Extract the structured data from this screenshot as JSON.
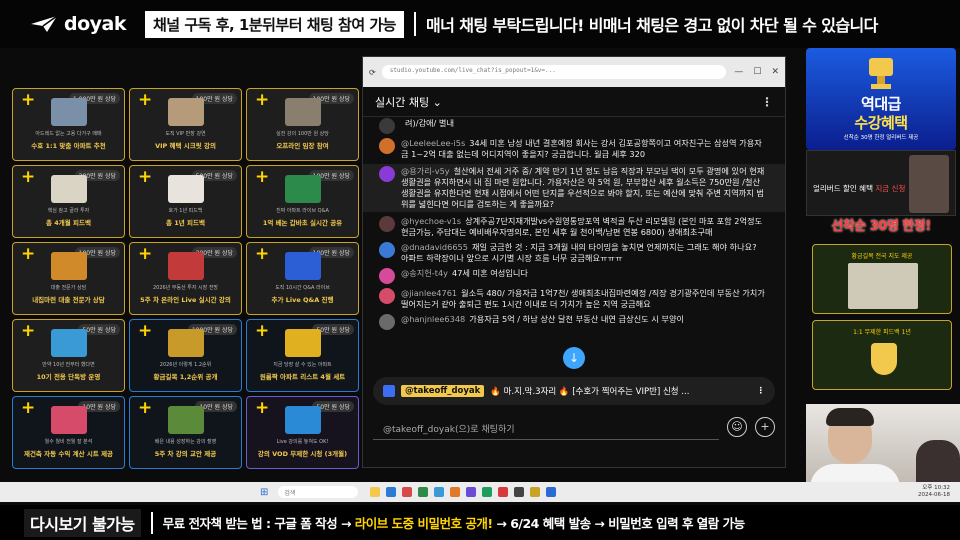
{
  "brand": {
    "name": "doyak"
  },
  "top_notice": {
    "subscribe_text": "채널 구독 후, 1분뒤부터 채팅 참여 가능",
    "manner_text": "매너 채팅 부탁드립니다! 비매너 채팅은 경고 없이 차단 될 수 있습니다"
  },
  "products": [
    {
      "price": "1,000만 원 상당",
      "desc": "아드레드 없는 고용 다가구 매매",
      "title": "수호 1:1 맞춤 아파트 추천",
      "color": "#7a8fa8",
      "style": "gold"
    },
    {
      "price": "100만 원 상당",
      "desc": "도직 VIP 반장 강연",
      "title": "VIP 혜택 시크릿 강의",
      "color": "#b59b7a",
      "style": "gold"
    },
    {
      "price": "100만 원 상당",
      "desc": "실전 강의 100만 원 상당",
      "title": "오프라인 임장 참여",
      "color": "#8a7f6e",
      "style": "gold"
    },
    {
      "price": "300만 원 상당",
      "desc": "핵심 참고 골라 투자",
      "title": "총 4개월 피드백",
      "color": "#d9d4c4",
      "style": "gold"
    },
    {
      "price": "500만 원 상당",
      "desc": "호가 1년 피드백",
      "title": "총 1년 피드백",
      "color": "#e8e3dc",
      "style": "gold"
    },
    {
      "price": "100만 원 상당",
      "desc": "진짜 아파트 라이브 Q&A",
      "title": "1억 베논 갑바초 실시간 공유",
      "color": "#2c8a4a",
      "style": "gold"
    },
    {
      "price": "100만 원 상당",
      "desc": "대출 전문가 상담",
      "title": "내집마련 대출 전문가 상담",
      "color": "#d08a2a",
      "style": "gold"
    },
    {
      "price": "300만 원 상당",
      "desc": "2026년 부동산 투자 시장 전망",
      "title": "5주 차 온라인 Live 실시간 강의",
      "color": "#c23a3a",
      "style": "gold"
    },
    {
      "price": "100만 원 상당",
      "desc": "도직 10시간 Q&A 라이브",
      "title": "추가 Live Q&A 진행",
      "color": "#2c5fd6",
      "style": "gold"
    },
    {
      "price": "50만 원 상당",
      "desc": "만약 10년 전부터 했다면",
      "title": "10기 전용 단독방 운영",
      "color": "#3a9ad6",
      "style": "gold"
    },
    {
      "price": "1000만 원 상당",
      "desc": "2026년 이렇게 1.2순위",
      "title": "황금길목 1,2순위 공개",
      "color": "#c89a2a",
      "style": "blue"
    },
    {
      "price": "50만 원 상당",
      "desc": "지금 당장 살 수 있는 아파트",
      "title": "원룸짝 아파트 리스트 4월 세트",
      "color": "#e0b020",
      "style": "blue"
    },
    {
      "price": "10만 원 상당",
      "desc": "월수 월비 전월 잘 분석",
      "title": "재건축 자동 수익 계산 시트 제공",
      "color": "#d64a6a",
      "style": "blue"
    },
    {
      "price": "10만 원 상당",
      "desc": "배은 내용 성장하는 강의 촬영",
      "title": "5주 차 강의 교안 제공",
      "color": "#5a8a3a",
      "style": "blue"
    },
    {
      "price": "50만 원 상당",
      "desc": "Live 강의를 놓쳐도 OK!",
      "title": "강의 VOD 무제한 시청 (3개월)",
      "color": "#2a8ad6",
      "style": "purple"
    }
  ],
  "browser": {
    "url": "studio.youtube.com/live_chat?is_popout=1&v=..."
  },
  "chat": {
    "header": "실시간 채팅 ⌄",
    "messages": [
      {
        "author": "",
        "text": "려)/감애/ 별내",
        "color": "#3a3a3a"
      },
      {
        "author": "@LeeleeLee-i5s",
        "text": "34세 미혼 남성 내년 결혼예정 회사는 강서 김포공항쪽이고 여자친구는 삼성역 가용자금 1~2억 대출 없는데 어디지역이 좋을지? 궁금합니다. 월급 세후 320",
        "color": "#d0702a"
      },
      {
        "author": "@용가리-v5y",
        "text": "철산에서 전세 거주 중/ 계약 만기 1년 정도 남음 직장과 부모님 댁이 모두 광명에 있어 현재 생활권을 유지하면서 내 집 마련 원합니다. 가용자산은 약 5억 원, 부부합산 세후 월소득은 750만원 /철산 생활권을 유지한다면 현재 시점에서 어떤 단지를 우선적으로 봐야 할지, 또는 예산에 맞춰 주변 지역까지 범위를 넓힌다면 어디를 검토하는 게 좋을까요?",
        "color": "#8a3ad6",
        "highlight": true
      },
      {
        "author": "@hyechoe-v1s",
        "text": "상계주공7단지재개발vs수원영통망포역 벽적골 두산 리모델링 (본인 마포 포함 2억정도 현금가능, 주담대는 예비배우자명의로, 본인 세후 월 천이백/남편 연봉 6800) 생애최초구매",
        "color": "#5a3a3a"
      },
      {
        "author": "@dnadavid6655",
        "text": "재일 궁금한 것 : 지금 3개월 내의 타이밍을 놓치면 언제까지는 그래도 해야 하나요? 아파트 하락장이나 앞으로 시기별 시장 흐름 너무 궁금해요ㅠㅠㅠ",
        "color": "#3a7ad6"
      },
      {
        "author": "@송지헌-t4y",
        "text": "47세 미혼 여성입니다",
        "color": "#d64a9a"
      },
      {
        "author": "@jianlee4761",
        "text": "월소득 480/ 가용자금 1억7천/ 생애최초내집마련예정 /직장 경기광주인데 부동산 가치가 떨어지는거 같아 출퇴근 편도 1시간 이내로 더 가치가 높은 지역 궁금해요",
        "color": "#d64a6a"
      },
      {
        "author": "@hanjnlee6348",
        "text": "가용자금 5억 / 하남 상산 달천 부동산 내연 급상신도 시 부양이",
        "color": "#6a6a6a"
      }
    ],
    "pinned_tag": "@takeoff_doyak",
    "pinned_text": "🔥 마.지.막.3자리 🔥 [수호가 찍어주는 VIP반] 신청 ...",
    "input_placeholder": "@takeoff_doyak(으)로 채팅하기"
  },
  "taskbar": {
    "search": "검색",
    "time": "오후 10:32",
    "date": "2024-06-18"
  },
  "bottom": {
    "replay": "다시보기 불가능",
    "text_prefix": "무료 전자책 받는 법 : 구글 폼 작성 → ",
    "text_highlight": "라이브 도중 비밀번호 공개!",
    "text_suffix": " → 6/24 혜택 발송 → 비밀번호 입력 후 열람 가능"
  },
  "ads": {
    "top_line1": "역대급",
    "top_line2": "수강혜택",
    "top_small": "선착순 30명 한정 얼리버드 제공",
    "mid_text": "얼리버드 할인 혜택",
    "mid_red": "지금 신청",
    "limit": "선착순 30명 한정!",
    "promo1": "황금길목 전국 지도 제공",
    "promo2": "1:1 무제한 피드백 1년"
  }
}
